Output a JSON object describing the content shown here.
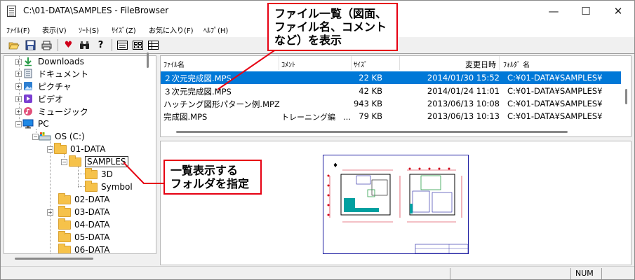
{
  "window": {
    "title": "C:\\01-DATA\\SAMPLES - FileBrowser",
    "controls": {
      "minimize": "—",
      "maximize": "☐",
      "close": "✕"
    }
  },
  "menu": [
    "ﾌｧｲﾙ(F)",
    "表示(V)",
    "ｿｰﾄ(S)",
    "ｻｲｽﾞ(Z)",
    "お気に入り(F)",
    "ﾍﾙﾌﾟ(H)"
  ],
  "toolbar": {
    "icons": [
      "open-folder-icon",
      "save-icon",
      "print-icon",
      "favorite-heart-icon",
      "find-binoculars-icon",
      "help-question-icon",
      "view-list-icon",
      "view-thumbnail-icon",
      "view-detail-icon"
    ]
  },
  "tree": {
    "items": [
      {
        "label": "Downloads",
        "icon": "download-arrow-icon",
        "color": "#2a9d4a"
      },
      {
        "label": "ドキュメント",
        "icon": "document-icon",
        "color": "#5a6b80"
      },
      {
        "label": "ピクチャ",
        "icon": "pictures-icon",
        "color": "#2f7fd1"
      },
      {
        "label": "ビデオ",
        "icon": "video-icon",
        "color": "#7b3fd1"
      },
      {
        "label": "ミュージック",
        "icon": "music-icon",
        "color": "#e2507a"
      },
      {
        "label": "PC",
        "icon": "pc-monitor-icon",
        "color": "#1e88e5"
      },
      {
        "label": "OS (C:)",
        "icon": "drive-icon",
        "color": "#607d8b"
      },
      {
        "label": "01-DATA",
        "icon": "folder-icon"
      },
      {
        "label": "SAMPLES",
        "icon": "folder-icon"
      },
      {
        "label": "3D",
        "icon": "folder-icon"
      },
      {
        "label": "Symbol",
        "icon": "folder-icon"
      },
      {
        "label": "02-DATA",
        "icon": "folder-icon"
      },
      {
        "label": "03-DATA",
        "icon": "folder-icon"
      },
      {
        "label": "04-DATA",
        "icon": "folder-icon"
      },
      {
        "label": "05-DATA",
        "icon": "folder-icon"
      },
      {
        "label": "06-DATA",
        "icon": "folder-icon"
      }
    ]
  },
  "filelist": {
    "columns": {
      "name": "ﾌｧｲﾙ名",
      "comment": "ｺﾒﾝﾄ",
      "size": "ｻｲｽﾞ",
      "modified": "変更日時",
      "folder": "ﾌｫﾙﾀﾞ 名"
    },
    "rows": [
      {
        "name": "２次元完成図.MPS",
        "comment": "",
        "size": "22 KB",
        "modified": "2014/01/30 15:52",
        "folder": "C:¥01-DATA¥SAMPLES¥"
      },
      {
        "name": "３次元完成図.MPS",
        "comment": "",
        "size": "42 KB",
        "modified": "2014/01/24 11:01",
        "folder": "C:¥01-DATA¥SAMPLES¥"
      },
      {
        "name": "ハッチング図形パターン例.MPZ",
        "comment": "",
        "size": "943 KB",
        "modified": "2013/06/13 10:08",
        "folder": "C:¥01-DATA¥SAMPLES¥"
      },
      {
        "name": "完成図.MPS",
        "comment": "トレーニング編　…",
        "size": "79 KB",
        "modified": "2013/06/13 10:13",
        "folder": "C:¥01-DATA¥SAMPLES¥"
      }
    ]
  },
  "status": {
    "num": "NUM"
  },
  "callouts": {
    "filelist": "ファイル一覧（図面、\nファイル名、コメント\nなど）を表示",
    "folder": "一覧表示する\nフォルダを指定"
  },
  "colors": {
    "accent": "#e60012",
    "selection": "#0078d7"
  }
}
